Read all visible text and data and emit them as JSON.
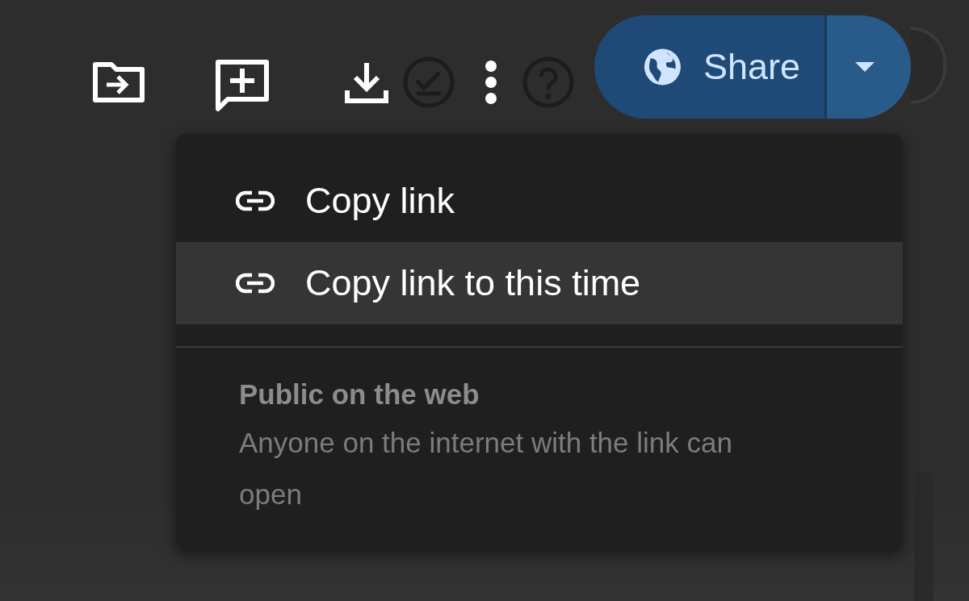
{
  "toolbar": {
    "buttons": [
      {
        "kind": "move",
        "disabled": false
      },
      {
        "kind": "comment",
        "disabled": false
      },
      {
        "kind": "download",
        "disabled": false
      },
      {
        "kind": "check",
        "disabled": true
      },
      {
        "kind": "more",
        "disabled": false
      },
      {
        "kind": "help",
        "disabled": true
      }
    ]
  },
  "share_button": {
    "label": "Share"
  },
  "menu": {
    "items": [
      {
        "label": "Copy link",
        "selected": false
      },
      {
        "label": "Copy link to this time",
        "selected": true
      }
    ],
    "section": {
      "title": "Public on the web",
      "description": "Anyone on the internet with the link can open"
    }
  }
}
